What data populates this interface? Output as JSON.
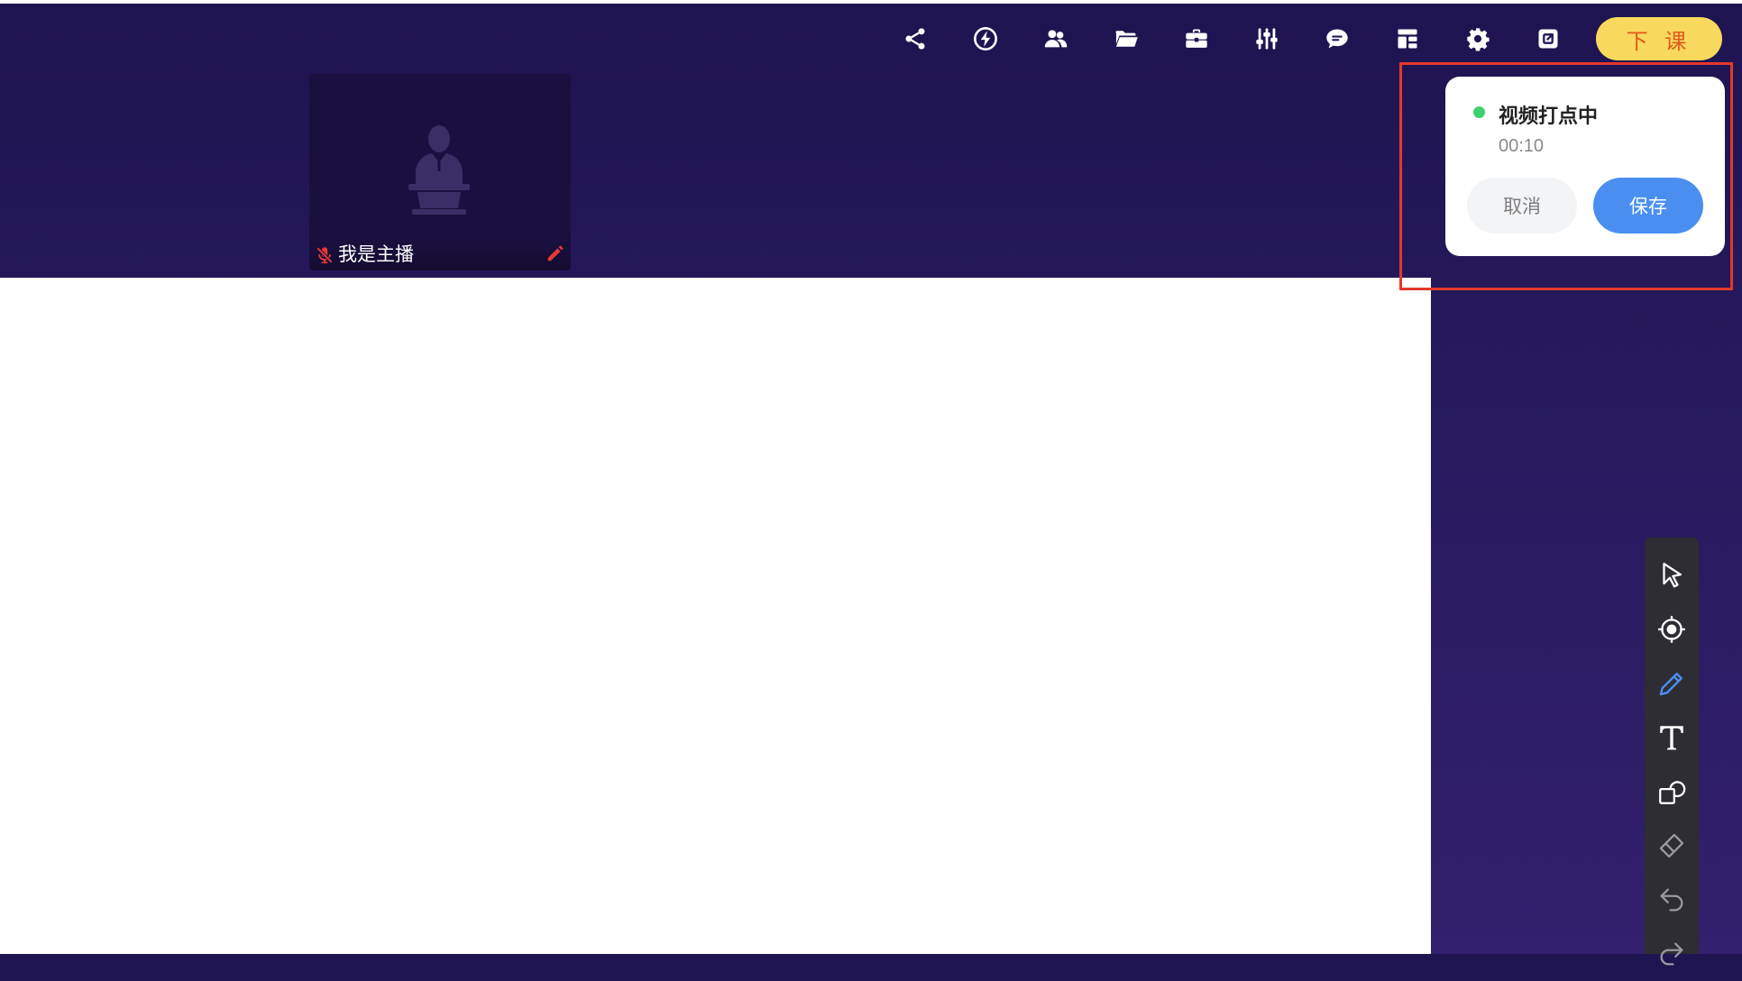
{
  "toolbar": {
    "icons": [
      "share-icon",
      "lightning-icon",
      "users-icon",
      "folder-icon",
      "toolbox-icon",
      "sliders-icon",
      "chat-icon",
      "layout-icon",
      "gear-icon",
      "popout-icon"
    ],
    "end_class_label": "下 课",
    "end_class_color": "#f9d85e"
  },
  "video_tile": {
    "name": "我是主播",
    "mic_status": "muted"
  },
  "marker_popup": {
    "title": "视频打点中",
    "elapsed": "00:10",
    "cancel_label": "取消",
    "save_label": "保存",
    "status_color": "#3ecf6e",
    "primary_color": "#4a8ff0"
  },
  "draw_tools": [
    "select-pointer-icon",
    "laser-pointer-icon",
    "pen-icon",
    "text-tool-icon",
    "shapes-icon",
    "eraser-icon",
    "undo-icon",
    "redo-icon"
  ],
  "colors": {
    "background": "#261a5c",
    "highlight_border": "#e4382b",
    "active_tool": "#4a8ff0"
  }
}
